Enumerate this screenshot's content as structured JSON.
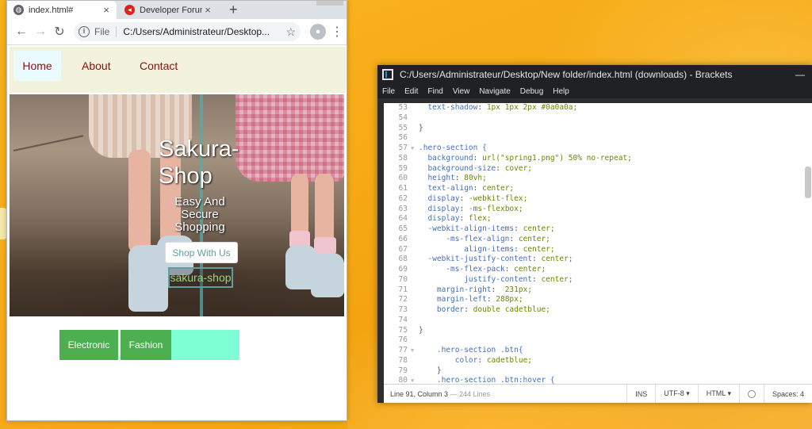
{
  "browser": {
    "tabs": [
      {
        "label": "index.html#",
        "close": "×"
      },
      {
        "label": "Developer Forum",
        "close": "×"
      }
    ],
    "newtab_glyph": "+",
    "toolbar": {
      "back_glyph": "←",
      "forward_glyph": "→",
      "reload_glyph": "↻",
      "info_glyph": "i",
      "protocol": "File",
      "url": "C:/Users/Administrateur/Desktop...",
      "star_glyph": "☆",
      "menu_glyph": "⋮"
    }
  },
  "site": {
    "nav": [
      "Home",
      "About",
      "Contact"
    ],
    "hero_title": "Sakura-Shop",
    "hero_subtitle": "Easy And Secure Shopping",
    "hero_button": "Shop With Us",
    "logo_text": "sakura-shop",
    "categories": [
      "Electronic",
      "Fashion"
    ]
  },
  "editor": {
    "title": "C:/Users/Administrateur/Desktop/New folder/index.html (downloads) - Brackets",
    "minimize_glyph": "—",
    "menu": [
      "File",
      "Edit",
      "Find",
      "View",
      "Navigate",
      "Debug",
      "Help"
    ],
    "lines": [
      {
        "n": "53",
        "fold": "",
        "text": "  text-shadow: 1px 1px 2px #0a0a0a;"
      },
      {
        "n": "54",
        "fold": "",
        "text": ""
      },
      {
        "n": "55",
        "fold": "",
        "text": "}"
      },
      {
        "n": "56",
        "fold": "",
        "text": ""
      },
      {
        "n": "57",
        "fold": "▼",
        "text": ".hero-section {"
      },
      {
        "n": "58",
        "fold": "",
        "text": "  background: url(\"spring1.png\") 50% no-repeat;"
      },
      {
        "n": "59",
        "fold": "",
        "text": "  background-size: cover;"
      },
      {
        "n": "60",
        "fold": "",
        "text": "  height: 80vh;"
      },
      {
        "n": "61",
        "fold": "",
        "text": "  text-align: center;"
      },
      {
        "n": "62",
        "fold": "",
        "text": "  display: -webkit-flex;"
      },
      {
        "n": "63",
        "fold": "",
        "text": "  display: -ms-flexbox;"
      },
      {
        "n": "64",
        "fold": "",
        "text": "  display: flex;"
      },
      {
        "n": "65",
        "fold": "",
        "text": "  -webkit-align-items: center;"
      },
      {
        "n": "66",
        "fold": "",
        "text": "      -ms-flex-align: center;"
      },
      {
        "n": "67",
        "fold": "",
        "text": "          align-items: center;"
      },
      {
        "n": "68",
        "fold": "",
        "text": "  -webkit-justify-content: center;"
      },
      {
        "n": "69",
        "fold": "",
        "text": "      -ms-flex-pack: center;"
      },
      {
        "n": "70",
        "fold": "",
        "text": "          justify-content: center;"
      },
      {
        "n": "71",
        "fold": "",
        "text": "    margin-right:  231px;"
      },
      {
        "n": "72",
        "fold": "",
        "text": "    margin-left: 288px;"
      },
      {
        "n": "73",
        "fold": "",
        "text": "    border: double cadetblue;"
      },
      {
        "n": "74",
        "fold": "",
        "text": ""
      },
      {
        "n": "75",
        "fold": "",
        "text": "}"
      },
      {
        "n": "76",
        "fold": "",
        "text": ""
      },
      {
        "n": "77",
        "fold": "▼",
        "text": "    .hero-section .btn{"
      },
      {
        "n": "78",
        "fold": "",
        "text": "        color: cadetblue;"
      },
      {
        "n": "79",
        "fold": "",
        "text": "    }"
      },
      {
        "n": "80",
        "fold": "▼",
        "text": "    .hero-section .btn:hover {"
      }
    ],
    "status": {
      "cursor": "Line 91, Column 3",
      "lines": " — 244 Lines",
      "ins": "INS",
      "encoding": "UTF-8 ▾",
      "language": "HTML ▾",
      "spaces": "Spaces: 4"
    }
  },
  "colors": {
    "nav_text": "#8b0e0e",
    "category_green": "#4caf50",
    "category_aqua": "#7fffd4",
    "cadetblue": "#5f9ea0"
  }
}
